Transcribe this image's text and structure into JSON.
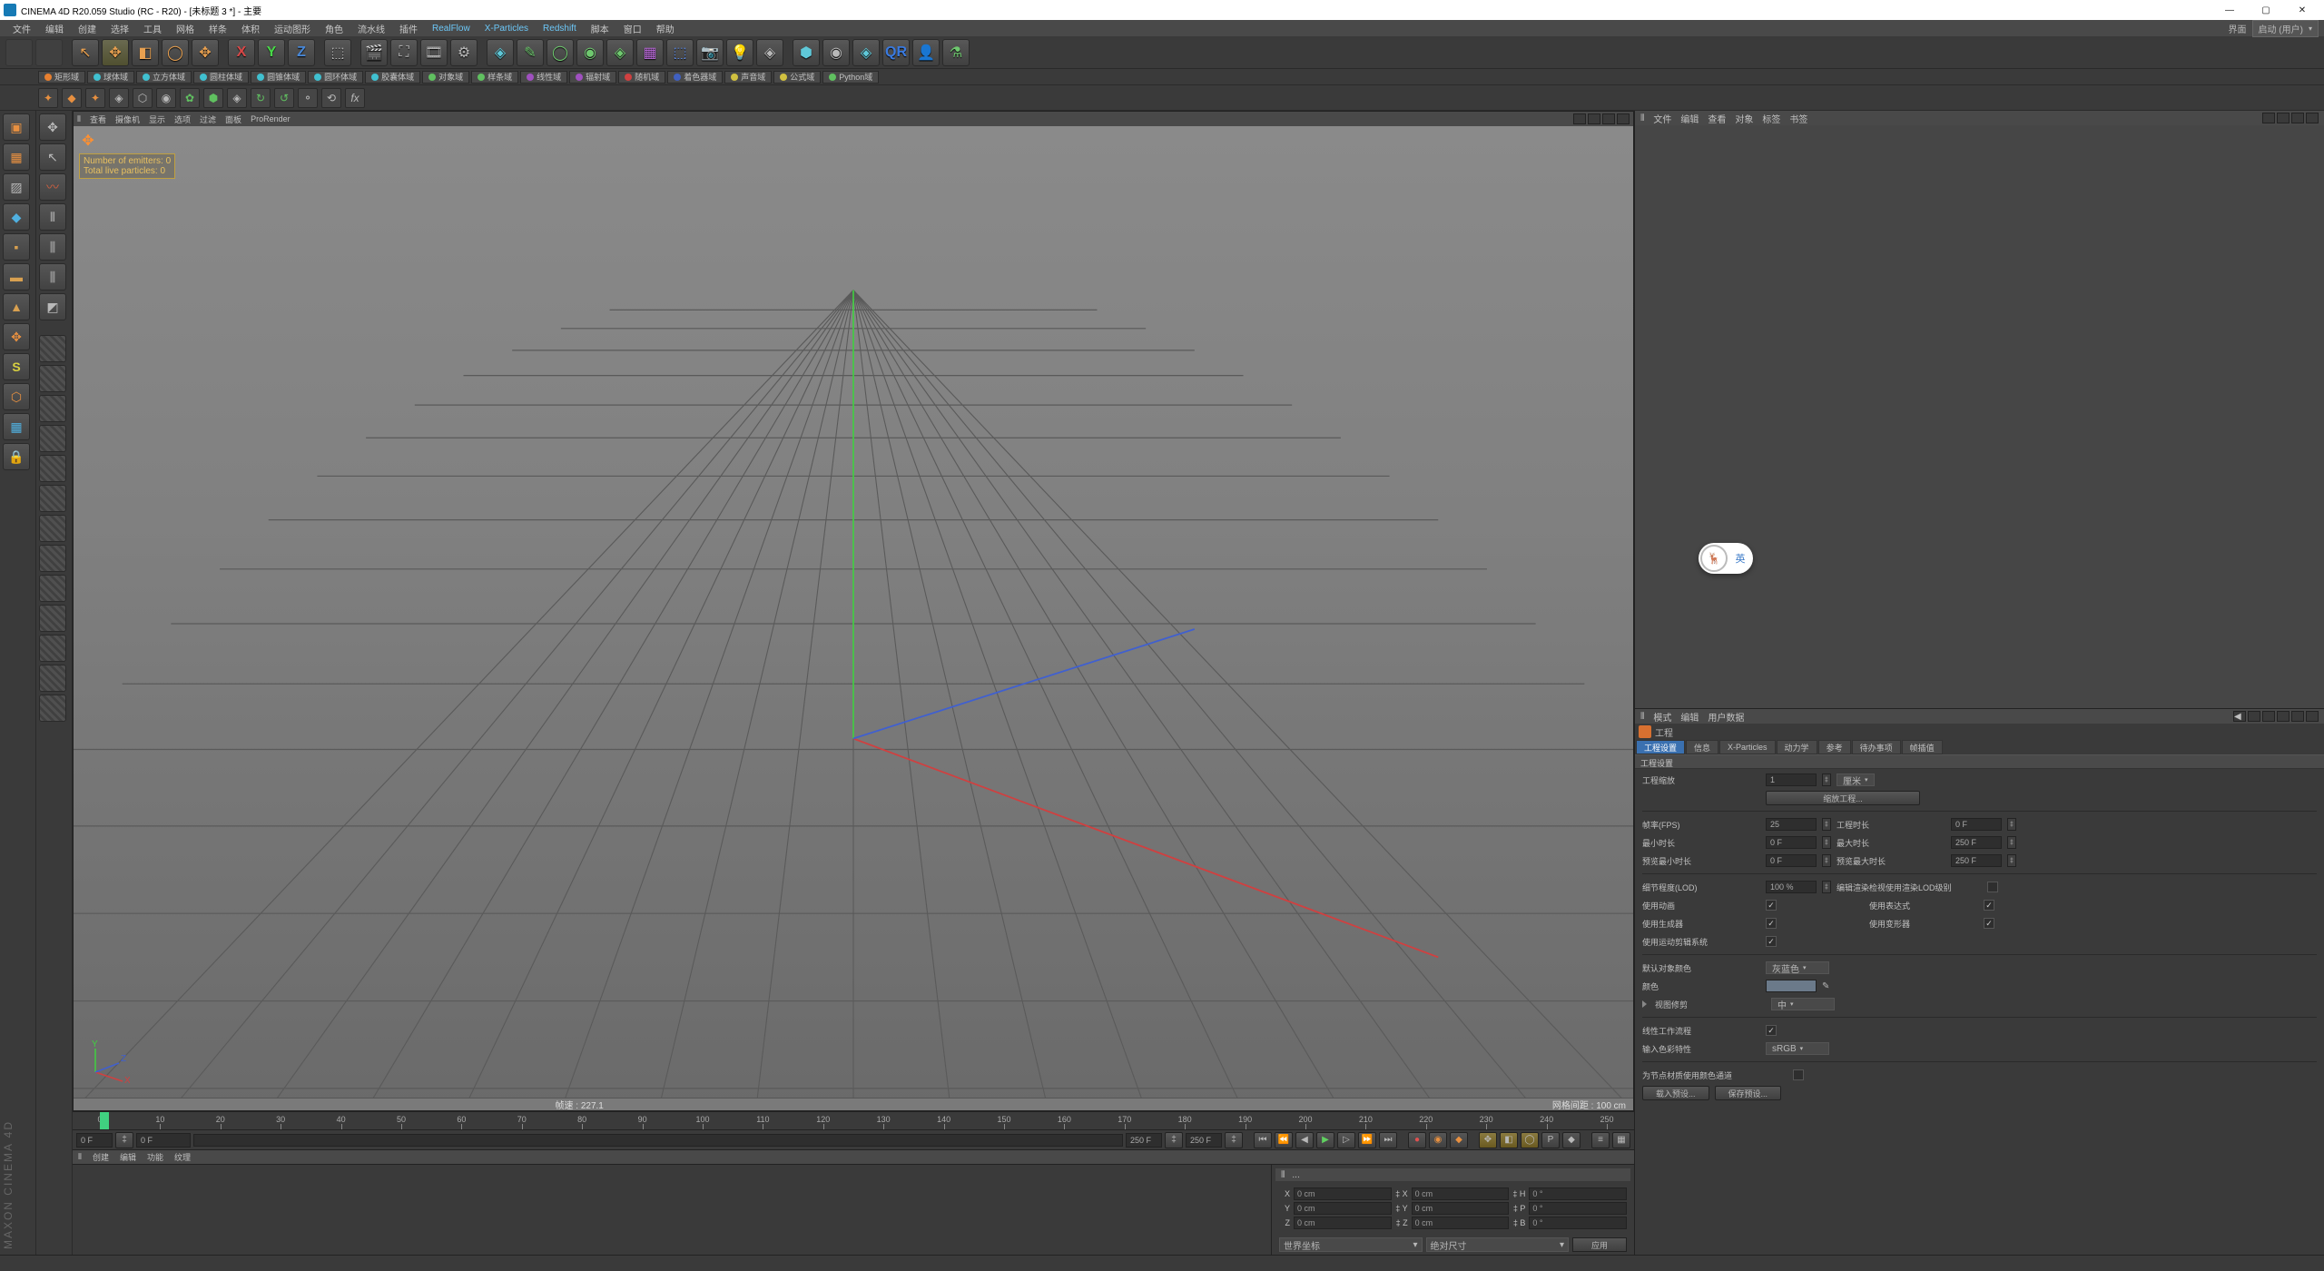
{
  "titlebar": {
    "text": "CINEMA 4D R20.059 Studio (RC - R20) - [未标题 3 *] - 主要"
  },
  "menubar": {
    "items": [
      "文件",
      "编辑",
      "创建",
      "选择",
      "工具",
      "网格",
      "样条",
      "体积",
      "运动图形",
      "角色",
      "流水线",
      "插件",
      "RealFlow",
      "X-Particles",
      "Redshift",
      "脚本",
      "窗口",
      "帮助"
    ],
    "layout_label": "界面",
    "layout_value": "启动 (用户)"
  },
  "sub_toolbar": [
    "矩形域",
    "球体域",
    "立方体域",
    "圆柱体域",
    "圆锥体域",
    "圆环体域",
    "胶囊体域",
    "对象域",
    "样条域",
    "线性域",
    "辐射域",
    "随机域",
    "着色器域",
    "声音域",
    "公式域",
    "Python域"
  ],
  "viewport_menu": [
    "查看",
    "摄像机",
    "显示",
    "选项",
    "过滤",
    "面板",
    "ProRender"
  ],
  "hud": {
    "line1": "Number of emitters: 0",
    "line2": "Total live particles: 0"
  },
  "status": {
    "fps": "帧速 : 227.1",
    "grid": "网格间距 : 100 cm"
  },
  "timeline": {
    "start": "0 F",
    "end": "250 F",
    "end2": "250 F",
    "ticks": [
      0,
      10,
      20,
      30,
      40,
      50,
      60,
      70,
      80,
      90,
      100,
      110,
      120,
      130,
      140,
      150,
      160,
      170,
      180,
      190,
      200,
      210,
      220,
      230,
      240,
      250
    ]
  },
  "bottom_tabs": [
    "创建",
    "编辑",
    "功能",
    "纹理"
  ],
  "coords": {
    "menu_items": [
      "三",
      "..."
    ],
    "x": "0 cm",
    "y": "0 cm",
    "z": "0 cm",
    "sx": "0 cm",
    "sy": "0 cm",
    "sz": "0 cm",
    "h": "0 °",
    "p": "0 °",
    "b": "0 °",
    "dd1": "世界坐标",
    "dd2": "绝对尺寸",
    "apply": "应用"
  },
  "obj_panel_menu": [
    "文件",
    "编辑",
    "查看",
    "对象",
    "标签",
    "书签"
  ],
  "float_label": "英",
  "attr": {
    "menu": [
      "模式",
      "编辑",
      "用户数据"
    ],
    "title": "工程",
    "tabs": [
      "工程设置",
      "信息",
      "X-Particles",
      "动力学",
      "参考",
      "待办事项",
      "帧插值"
    ],
    "section": "工程设置",
    "scale_label": "工程缩放",
    "scale_val": "1",
    "scale_unit": "厘米",
    "scale_btn": "缩放工程...",
    "fps_label": "帧率(FPS)",
    "fps_val": "25",
    "proj_time_label": "工程时长",
    "proj_time_val": "0 F",
    "min_time_label": "最小时长",
    "min_time_val": "0 F",
    "max_time_label": "最大时长",
    "max_time_val": "250 F",
    "prev_min_label": "预览最小时长",
    "prev_min_val": "0 F",
    "prev_max_label": "预览最大时长",
    "prev_max_val": "250 F",
    "lod_label": "细节程度(LOD)",
    "lod_val": "100 %",
    "lod_render_label": "编辑渲染检视使用渲染LOD级别",
    "use_anim_label": "使用动画",
    "use_expr_label": "使用表达式",
    "use_gen_label": "使用生成器",
    "use_def_label": "使用变形器",
    "use_motion_label": "使用运动剪辑系统",
    "def_color_label": "默认对象颜色",
    "def_color_val": "灰蓝色",
    "color_label": "颜色",
    "view_clip_label": "视图修剪",
    "view_clip_val": "中",
    "linear_label": "线性工作流程",
    "input_cs_label": "输入色彩特性",
    "input_cs_val": "sRGB",
    "node_color_label": "为节点材质使用颜色通道",
    "load_btn": "载入预设...",
    "save_btn": "保存预设..."
  },
  "brand": "MAXON CINEMA 4D"
}
